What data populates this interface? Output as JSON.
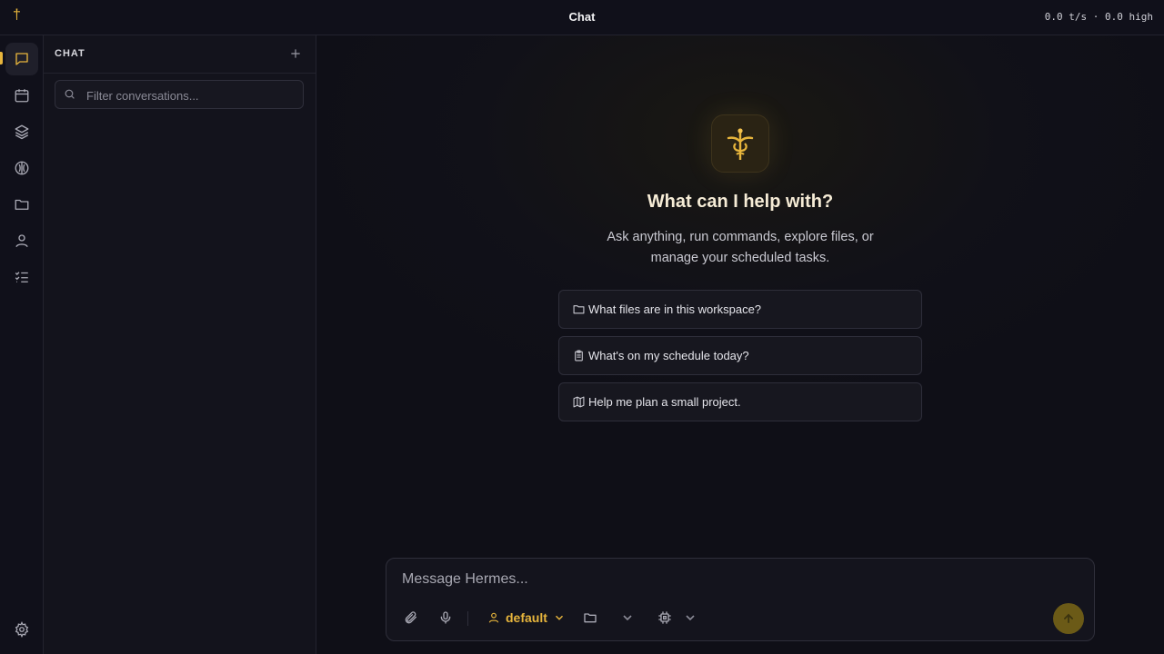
{
  "topbar": {
    "app_mark": "†",
    "title": "Chat",
    "stats": "0.0 t/s · 0.0 high"
  },
  "rail": {
    "items": [
      {
        "name": "chat",
        "icon": "chat-bubble-icon",
        "active": true
      },
      {
        "name": "calendar",
        "icon": "calendar-icon"
      },
      {
        "name": "layers",
        "icon": "layers-icon"
      },
      {
        "name": "brain",
        "icon": "brain-icon"
      },
      {
        "name": "files",
        "icon": "folder-icon"
      },
      {
        "name": "profile",
        "icon": "user-icon"
      },
      {
        "name": "tasks",
        "icon": "checklist-icon"
      }
    ],
    "settings_icon": "gear-icon"
  },
  "sidebar": {
    "title": "CHAT",
    "filter_placeholder": "Filter conversations..."
  },
  "main": {
    "hero_title": "What can I help with?",
    "hero_subtitle": "Ask anything, run commands, explore files, or manage your scheduled tasks.",
    "suggestions": [
      {
        "icon": "folder-icon",
        "label": "What files are in this workspace?"
      },
      {
        "icon": "clipboard-icon",
        "label": "What's on my schedule today?"
      },
      {
        "icon": "map-icon",
        "label": "Help me plan a small project."
      }
    ]
  },
  "composer": {
    "placeholder": "Message Hermes...",
    "persona": "default"
  },
  "colors": {
    "accent": "#e7b53c",
    "background": "#0f0f17"
  }
}
